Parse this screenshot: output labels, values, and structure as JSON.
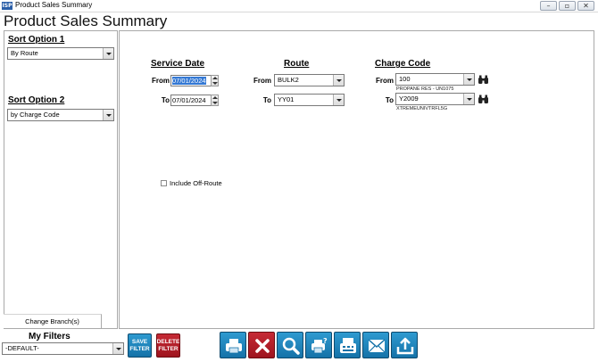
{
  "window": {
    "title": "Product Sales Summary",
    "icon": "app-logo-icon",
    "controls": [
      "minimize-icon",
      "restore-icon",
      "close-icon"
    ]
  },
  "app": {
    "title": "Product Sales Summary"
  },
  "sidebar": {
    "sort1": {
      "label": "Sort Option 1",
      "value": "By Route"
    },
    "sort2": {
      "label": "Sort Option 2",
      "value": "by Charge Code"
    },
    "change_branch": "Change Branch(s)"
  },
  "service_date": {
    "heading": "Service Date",
    "from_label": "From",
    "from_value": "07/01/2024",
    "to_label": "To",
    "to_value": "07/01/2024"
  },
  "route": {
    "heading": "Route",
    "from_label": "From",
    "from_value": "BULK2",
    "to_label": "To",
    "to_value": "YY01"
  },
  "charge_code": {
    "heading": "Charge Code",
    "from_label": "From",
    "from_value": "100",
    "from_desc": "PROPANE RES - UN1075",
    "to_label": "To",
    "to_value": "Y2009",
    "to_desc": "XTREMEUNIVTRFL5G"
  },
  "options": {
    "include_off_route": "Include Off-Route",
    "include_off_route_checked": false
  },
  "filters": {
    "label": "My Filters",
    "value": "-DEFAULT-",
    "save_label": "SAVE FILTER",
    "delete_label": "DELETE FILTER"
  },
  "toolbar": {
    "icons": [
      "printer-icon",
      "close-x-icon",
      "search-icon",
      "print-preview-icon",
      "fax-icon",
      "email-icon",
      "export-icon"
    ]
  },
  "colors": {
    "ribbon_blue": "#1a7fb8",
    "ribbon_red": "#b01e28",
    "selection": "#3378d4"
  }
}
